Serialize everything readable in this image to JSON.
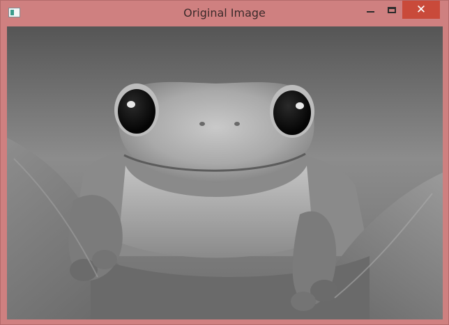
{
  "window": {
    "title": "Original Image",
    "app_icon": "window-app-icon",
    "controls": {
      "minimize_icon": "minimize-icon",
      "maximize_icon": "maximize-icon",
      "close_icon": "close-icon",
      "close_glyph": "✕"
    }
  },
  "image": {
    "subject": "grayscale frog on leaves",
    "colors": {
      "titlebar": "#cf8080",
      "close_button": "#c94a3a"
    }
  }
}
